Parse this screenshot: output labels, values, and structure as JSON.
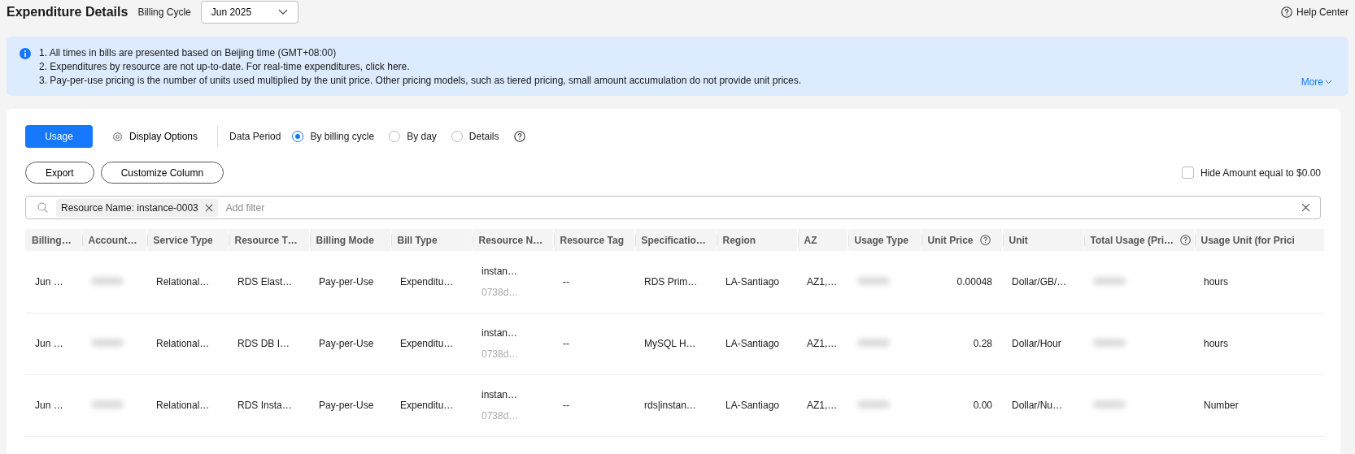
{
  "header": {
    "title": "Expenditure Details",
    "billing_cycle_label": "Billing Cycle",
    "billing_cycle_value": "Jun 2025",
    "help": "Help Center"
  },
  "notice": {
    "lines": [
      "1. All times in bills are presented based on Beijing time (GMT+08:00)",
      "2. Expenditures by resource are not up-to-date. For real-time expenditures, click here.",
      "3. Pay-per-use pricing is the number of units used multiplied by the unit price. Other pricing models, such as tiered pricing, small amount accumulation do not provide unit prices."
    ],
    "more": "More"
  },
  "toolbar": {
    "usage_button": "Usage",
    "display_options": "Display Options",
    "data_period_label": "Data Period",
    "periods": [
      {
        "label": "By billing cycle",
        "selected": true
      },
      {
        "label": "By day",
        "selected": false
      },
      {
        "label": "Details",
        "selected": false
      }
    ]
  },
  "actions": {
    "buttons": [
      "Export",
      "Customize Column"
    ],
    "hide_zero": {
      "label": "Hide Amount equal to $0.00",
      "checked": false
    }
  },
  "filter": {
    "tag": "Resource Name: instance-0003",
    "placeholder": "Add filter"
  },
  "table": {
    "columns": [
      {
        "label": "Billing…",
        "help": false
      },
      {
        "label": "Account…",
        "help": false
      },
      {
        "label": "Service Type",
        "help": false
      },
      {
        "label": "Resource T…",
        "help": false
      },
      {
        "label": "Billing Mode",
        "help": false
      },
      {
        "label": "Bill Type",
        "help": false
      },
      {
        "label": "Resource N…",
        "help": false
      },
      {
        "label": "Resource Tag",
        "help": false
      },
      {
        "label": "Specificatio…",
        "help": false
      },
      {
        "label": "Region",
        "help": false
      },
      {
        "label": "AZ",
        "help": false
      },
      {
        "label": "Usage Type",
        "help": false
      },
      {
        "label": "Unit Price",
        "help": true
      },
      {
        "label": "Unit",
        "help": false
      },
      {
        "label": "Total Usage (Pri…",
        "help": true
      },
      {
        "label": "Usage Unit (for Prici",
        "help": false
      }
    ],
    "rows": [
      {
        "cells": [
          {
            "kind": "text",
            "text": "Jun …"
          },
          {
            "kind": "blurred"
          },
          {
            "kind": "text",
            "text": "Relational…"
          },
          {
            "kind": "text",
            "text": "RDS Elast…"
          },
          {
            "kind": "text",
            "text": "Pay-per-Use"
          },
          {
            "kind": "text",
            "text": "Expenditu…"
          },
          {
            "kind": "two_line",
            "text": "instan…",
            "subtext": "0738d…"
          },
          {
            "kind": "text",
            "text": "--"
          },
          {
            "kind": "text",
            "text": "RDS Prim…"
          },
          {
            "kind": "text",
            "text": "LA-Santiago"
          },
          {
            "kind": "text",
            "text": "AZ1,…"
          },
          {
            "kind": "blurred"
          },
          {
            "kind": "number",
            "text": "0.00048"
          },
          {
            "kind": "text",
            "text": "Dollar/GB/…"
          },
          {
            "kind": "blurred"
          },
          {
            "kind": "text",
            "text": "hours"
          }
        ]
      },
      {
        "cells": [
          {
            "kind": "text",
            "text": "Jun …"
          },
          {
            "kind": "blurred"
          },
          {
            "kind": "text",
            "text": "Relational…"
          },
          {
            "kind": "text",
            "text": "RDS DB I…"
          },
          {
            "kind": "text",
            "text": "Pay-per-Use"
          },
          {
            "kind": "text",
            "text": "Expenditu…"
          },
          {
            "kind": "two_line",
            "text": "instan…",
            "subtext": "0738d…"
          },
          {
            "kind": "text",
            "text": "--"
          },
          {
            "kind": "text",
            "text": "MySQL H…"
          },
          {
            "kind": "text",
            "text": "LA-Santiago"
          },
          {
            "kind": "text",
            "text": "AZ1,…"
          },
          {
            "kind": "blurred"
          },
          {
            "kind": "number",
            "text": "0.28"
          },
          {
            "kind": "text",
            "text": "Dollar/Hour"
          },
          {
            "kind": "blurred"
          },
          {
            "kind": "text",
            "text": "hours"
          }
        ]
      },
      {
        "cells": [
          {
            "kind": "text",
            "text": "Jun …"
          },
          {
            "kind": "blurred"
          },
          {
            "kind": "text",
            "text": "Relational…"
          },
          {
            "kind": "text",
            "text": "RDS Insta…"
          },
          {
            "kind": "text",
            "text": "Pay-per-Use"
          },
          {
            "kind": "text",
            "text": "Expenditu…"
          },
          {
            "kind": "two_line",
            "text": "instan…",
            "subtext": "0738d…"
          },
          {
            "kind": "text",
            "text": "--"
          },
          {
            "kind": "text",
            "text": "rds|instan…"
          },
          {
            "kind": "text",
            "text": "LA-Santiago"
          },
          {
            "kind": "text",
            "text": "AZ1,…"
          },
          {
            "kind": "blurred"
          },
          {
            "kind": "number",
            "text": "0.00"
          },
          {
            "kind": "text",
            "text": "Dollar/Nu…"
          },
          {
            "kind": "blurred"
          },
          {
            "kind": "text",
            "text": "Number"
          }
        ]
      }
    ]
  }
}
